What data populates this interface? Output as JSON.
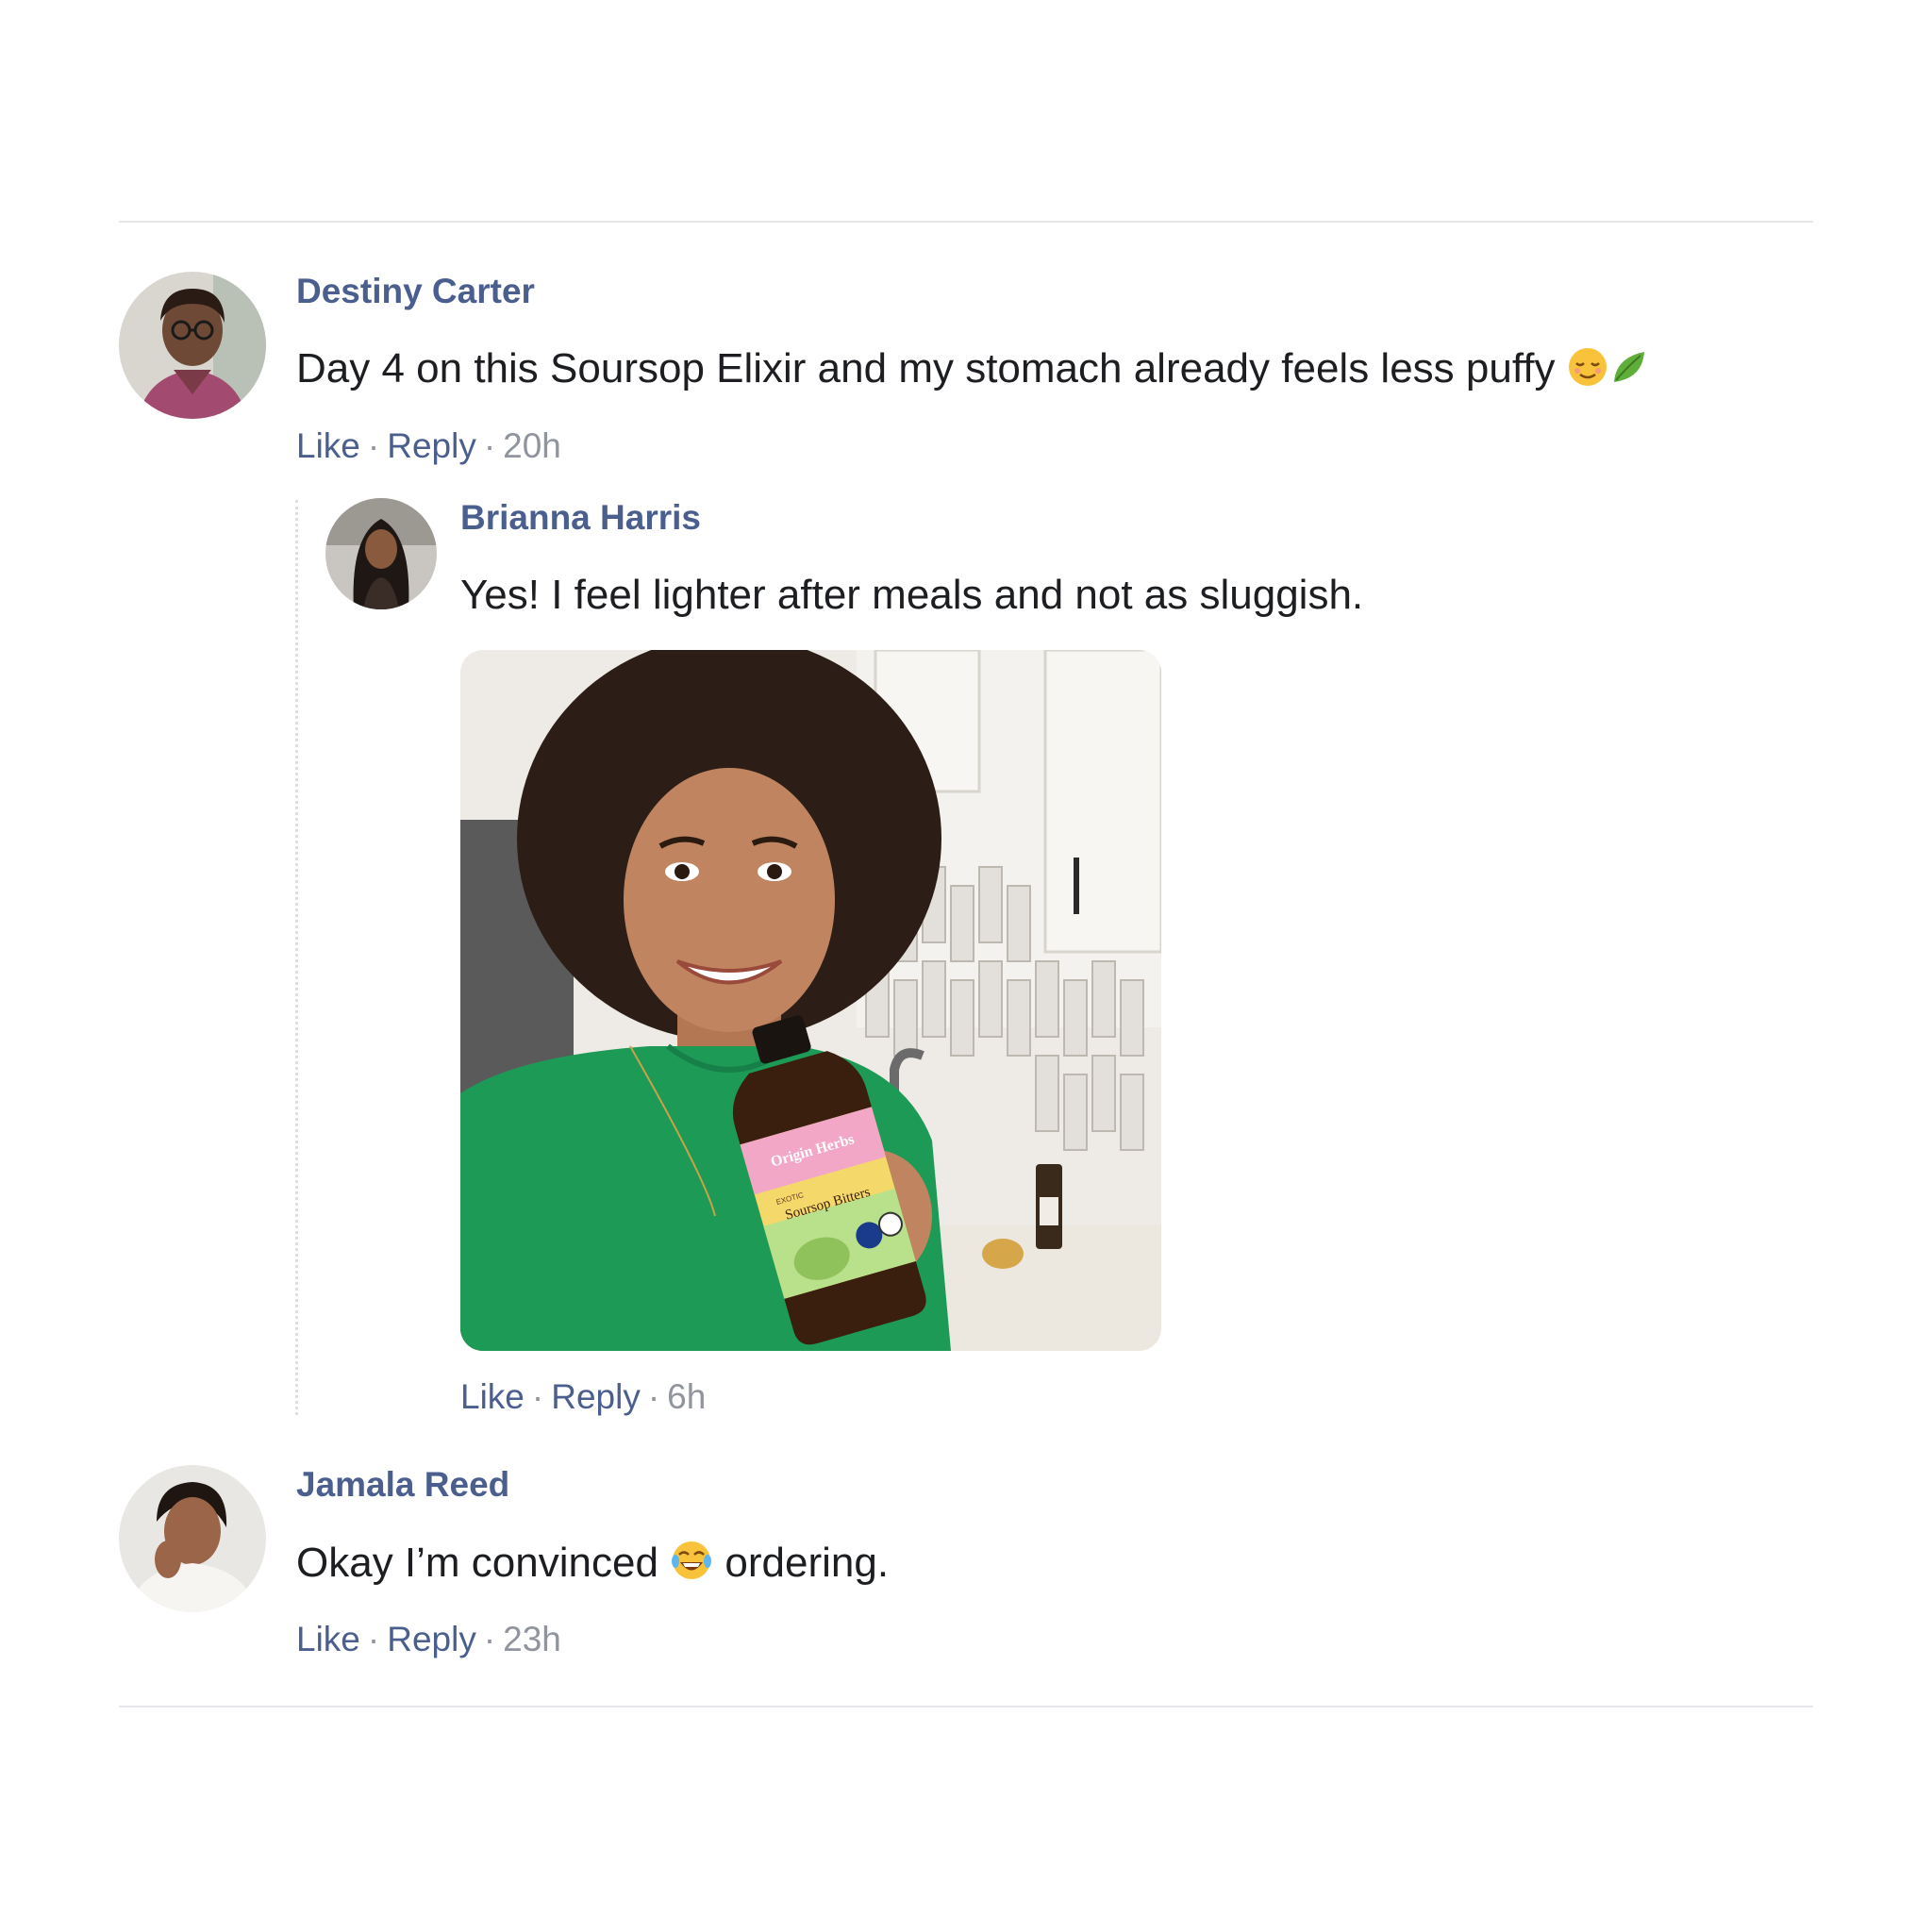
{
  "comments": [
    {
      "author": "Destiny Carter",
      "text": "Day 4 on this Soursop Elixir and my stomach already feels less puffy",
      "emojis": [
        "relieved-face-emoji",
        "leaf-emoji"
      ],
      "like_label": "Like",
      "reply_label": "Reply",
      "time": "20h"
    },
    {
      "author": "Jamala Reed",
      "text_before": "Okay I’m convinced",
      "text_after": "ordering.",
      "emojis": [
        "tears-of-joy-emoji"
      ],
      "like_label": "Like",
      "reply_label": "Reply",
      "time": "23h"
    }
  ],
  "reply": {
    "author": "Brianna Harris",
    "text": "Yes! I feel lighter after meals and not as sluggish.",
    "like_label": "Like",
    "reply_label": "Reply",
    "time": "6h",
    "photo": {
      "bottle_brand": "Origin Herbs",
      "bottle_product": "Soursop Bitters",
      "bottle_tag": "EXOTIC"
    }
  },
  "separator": "·",
  "colors": {
    "author_link": "#4b5f8f",
    "body_text": "#1c1e21",
    "meta_gray": "#90949c",
    "divider": "#e4e6ea"
  }
}
